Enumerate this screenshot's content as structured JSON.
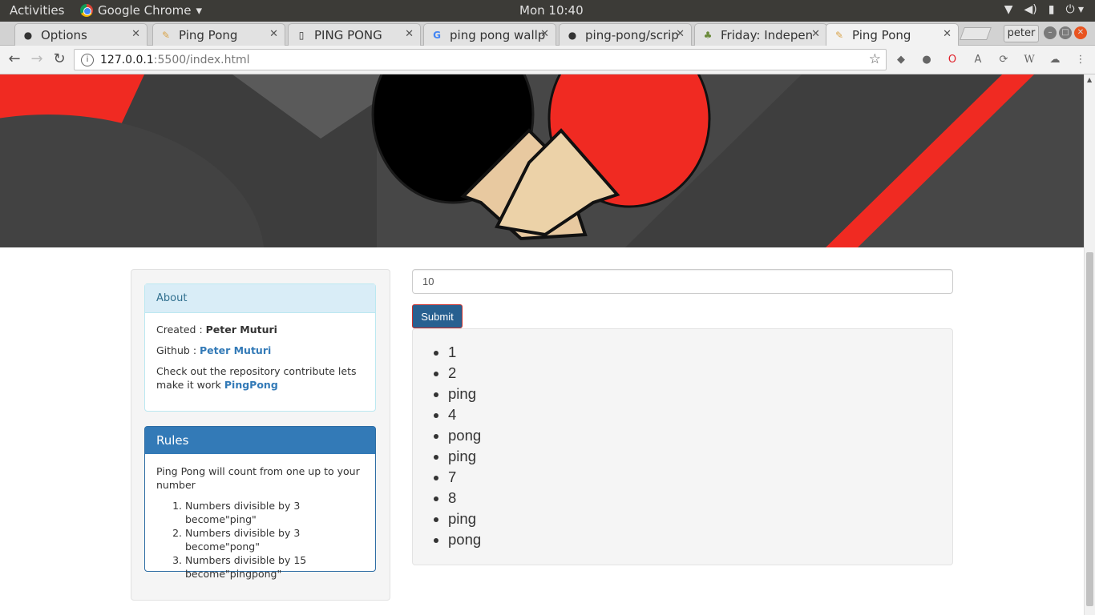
{
  "system": {
    "activities": "Activities",
    "app_name": "Google Chrome",
    "clock": "Mon 10:40"
  },
  "tabs": [
    {
      "label": "Options",
      "icon": "github-icon"
    },
    {
      "label": "Ping Pong",
      "icon": "pingpong-favicon"
    },
    {
      "label": "PING PONG",
      "icon": "document-icon"
    },
    {
      "label": "ping pong wallp",
      "icon": "google-icon"
    },
    {
      "label": "ping-pong/scrip",
      "icon": "github-icon"
    },
    {
      "label": "Friday: Indepen",
      "icon": "tree-icon"
    },
    {
      "label": "Ping Pong",
      "icon": "pingpong-favicon",
      "active": true
    }
  ],
  "profile_name": "peter",
  "address": {
    "host": "127.0.0.1",
    "path": ":5500/index.html"
  },
  "about": {
    "title": "About",
    "created_label": "Created : ",
    "created_name": "Peter Muturi",
    "github_label": "Github : ",
    "github_name": "Peter Muturi",
    "repo_text": "Check out the repository contribute lets make it work ",
    "repo_link": "PingPong"
  },
  "rules": {
    "title": "Rules",
    "intro": "Ping Pong will count from one up to your number",
    "items": [
      "Numbers divisible by 3 become\"ping\"",
      "Numbers divisible by 3 become\"pong\"",
      "Numbers divisible by 15 become\"pingpong\""
    ]
  },
  "form": {
    "input_value": "10",
    "submit_label": "Submit"
  },
  "results": [
    "1",
    "2",
    "ping",
    "4",
    "pong",
    "ping",
    "7",
    "8",
    "ping",
    "pong"
  ],
  "colors": {
    "accent_red": "#f02a22",
    "panel_blue": "#337ab7",
    "hero_dark": "#474747"
  }
}
